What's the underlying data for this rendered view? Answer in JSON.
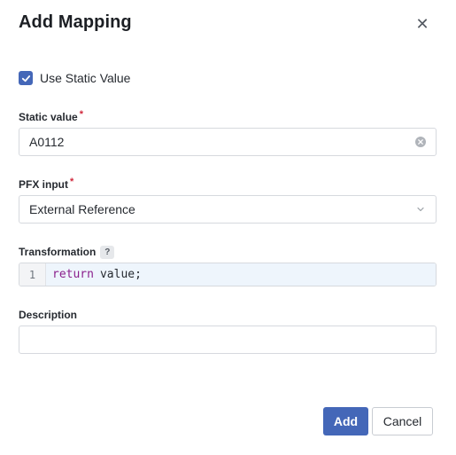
{
  "dialog": {
    "title": "Add Mapping",
    "close_glyph": "✕"
  },
  "use_static": {
    "label": "Use Static Value",
    "checked": true
  },
  "static_value": {
    "label": "Static value",
    "required_mark": "*",
    "value": "A0112"
  },
  "pfx_input": {
    "label": "PFX input",
    "required_mark": "*",
    "selected": "External Reference"
  },
  "transformation": {
    "label": "Transformation",
    "help_badge": "?",
    "line_number": "1",
    "code_keyword": "return",
    "code_rest": "value;"
  },
  "description": {
    "label": "Description",
    "value": ""
  },
  "buttons": {
    "add": "Add",
    "cancel": "Cancel"
  },
  "colors": {
    "accent": "#4467b8",
    "required": "#d0283c",
    "keyword": "#8a1f8c"
  },
  "icons": {
    "close": "close-icon",
    "check": "check-icon",
    "clear": "clear-icon",
    "chevron": "chevron-down-icon"
  }
}
